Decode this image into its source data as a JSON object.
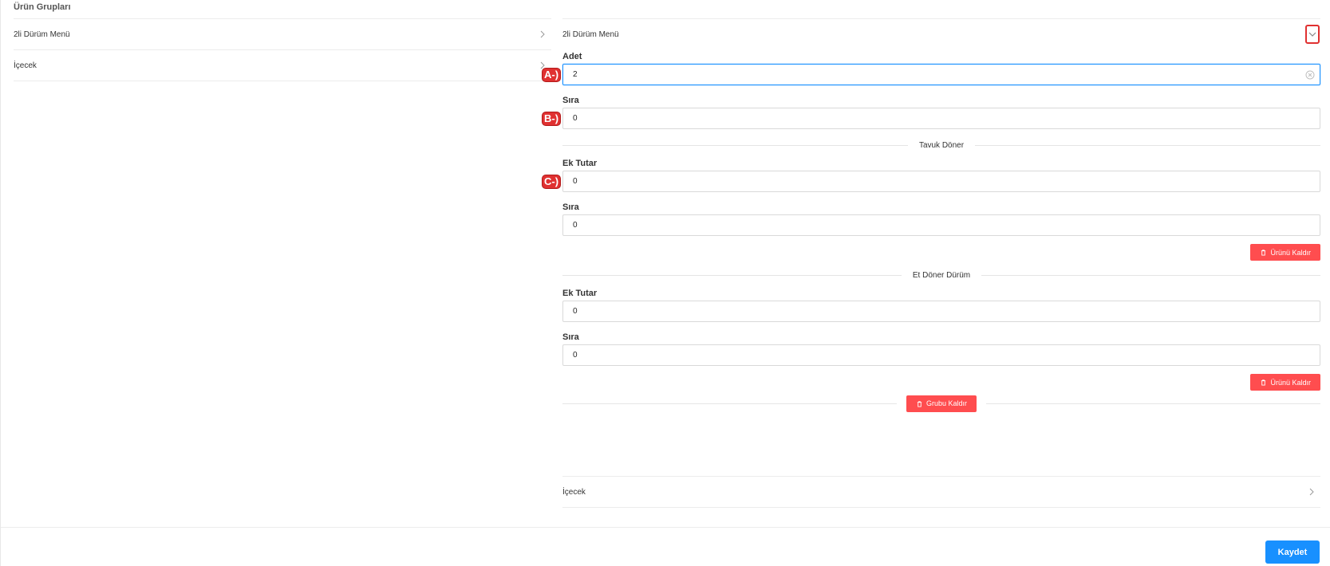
{
  "section_title": "Ürün Grupları",
  "left_list": [
    {
      "label": "2li Dürüm Menü"
    },
    {
      "label": "İçecek"
    }
  ],
  "group": {
    "title": "2li Dürüm Menü",
    "adet_label": "Adet",
    "adet_value": "2",
    "sira_label": "Sıra",
    "sira_value": "0",
    "markers": {
      "a": "A-)",
      "b": "B-)",
      "c": "C-)"
    },
    "products": [
      {
        "name": "Tavuk Döner",
        "ek_tutar_label": "Ek Tutar",
        "ek_tutar_value": "0",
        "sira_label": "Sıra",
        "sira_value": "0",
        "remove_label": "Ürünü Kaldır"
      },
      {
        "name": "Et Döner Dürüm",
        "ek_tutar_label": "Ek Tutar",
        "ek_tutar_value": "0",
        "sira_label": "Sıra",
        "sira_value": "0",
        "remove_label": "Ürünü Kaldır"
      }
    ],
    "remove_group_label": "Grubu Kaldır"
  },
  "bottom_item": {
    "label": "İçecek"
  },
  "footer": {
    "save_label": "Kaydet"
  },
  "colors": {
    "primary": "#1890ff",
    "danger": "#ff4d4f",
    "marker": "#e03131"
  }
}
